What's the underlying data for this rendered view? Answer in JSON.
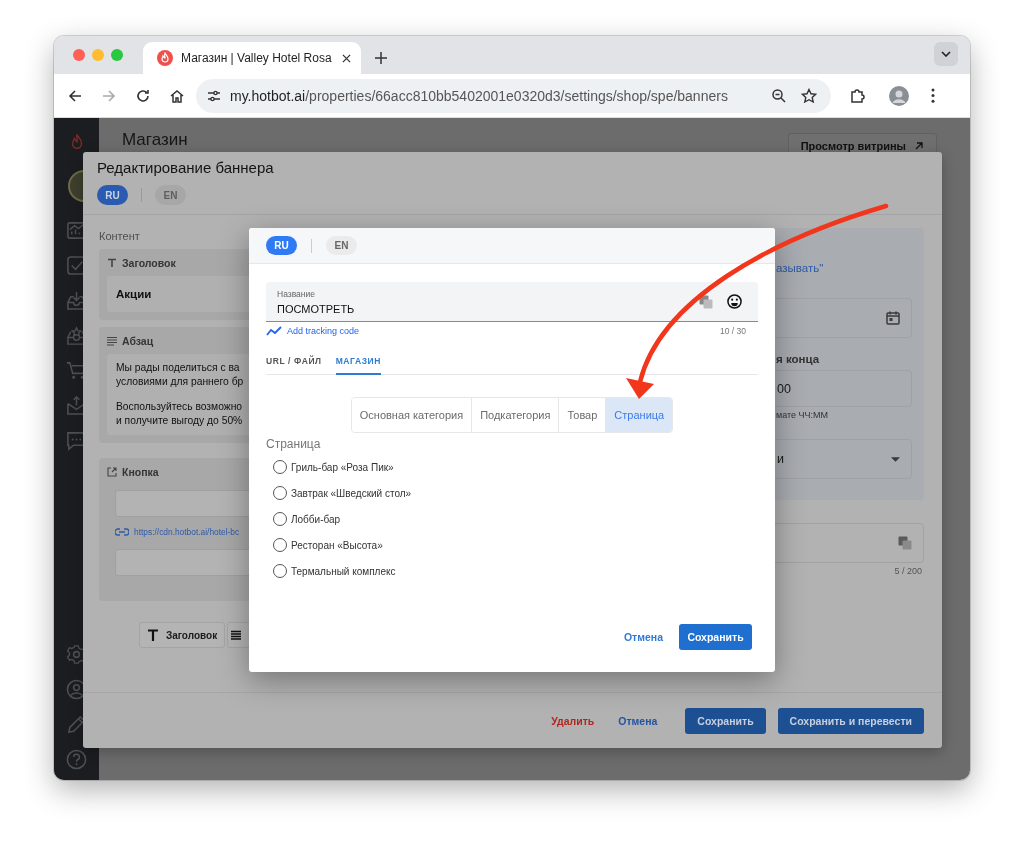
{
  "browser": {
    "tab_title": "Магазин | Valley Hotel Rosa",
    "url_host": "my.hotbot.ai",
    "url_path": "/properties/66acc810bb5402001e0320d3/settings/shop/spe/banners"
  },
  "page": {
    "title": "Магазин",
    "storefront_button": "Просмотр витрины"
  },
  "banner_dialog": {
    "title": "Редактирование баннера",
    "languages": [
      {
        "label": "RU",
        "selected": true
      },
      {
        "label": "EN",
        "selected": false
      }
    ],
    "section_label": "Контент",
    "blocks": [
      {
        "kind": "heading",
        "label": "Заголовок",
        "value": "Акции"
      },
      {
        "kind": "paragraph",
        "label": "Абзац",
        "paragraphs": [
          [
            "Мы рады поделиться с ва",
            "условиями для раннего бр"
          ],
          [
            "Воспользуйтесь возможно",
            "и получите выгоду до 50%"
          ]
        ]
      },
      {
        "kind": "button",
        "label": "Кнопка",
        "link": "https://cdn.hotbot.ai/hotel-bc"
      }
    ],
    "add_buttons": [
      {
        "kind": "heading",
        "label": "Заголовок"
      },
      {
        "kind": "paragraph"
      }
    ],
    "settings": {
      "link_fragment": "азывать\"",
      "end_time_label": "я конца",
      "end_time_value": "00",
      "time_hint": "мате ЧЧ:ММ",
      "select_value": "и",
      "counter": "5 / 200"
    },
    "footer": {
      "delete": "Удалить",
      "cancel": "Отмена",
      "save": "Сохранить",
      "save_translate": "Сохранить и перевести"
    }
  },
  "link_dialog": {
    "languages": [
      {
        "label": "RU",
        "selected": true
      },
      {
        "label": "EN",
        "selected": false
      }
    ],
    "name_field": {
      "label": "Название",
      "value": "ПОСМОТРЕТЬ",
      "counter": "10 / 30"
    },
    "tracking_link": "Add tracking code",
    "tabs": [
      {
        "label": "URL / ФАЙЛ",
        "selected": false
      },
      {
        "label": "МАГАЗИН",
        "selected": true
      }
    ],
    "segments": [
      {
        "label": "Основная категория",
        "selected": false
      },
      {
        "label": "Подкатегория",
        "selected": false
      },
      {
        "label": "Товар",
        "selected": false
      },
      {
        "label": "Страница",
        "selected": true
      }
    ],
    "list_label": "Страница",
    "options": [
      {
        "label": "Гриль-бар «Роза Пик»",
        "selected": false
      },
      {
        "label": "Завтрак «Шведский стол»",
        "selected": false
      },
      {
        "label": "Лобби-бар",
        "selected": false
      },
      {
        "label": "Ресторан «Высота»",
        "selected": false
      },
      {
        "label": "Термальный комплекс",
        "selected": false
      }
    ],
    "cancel": "Отмена",
    "save": "Сохранить"
  }
}
